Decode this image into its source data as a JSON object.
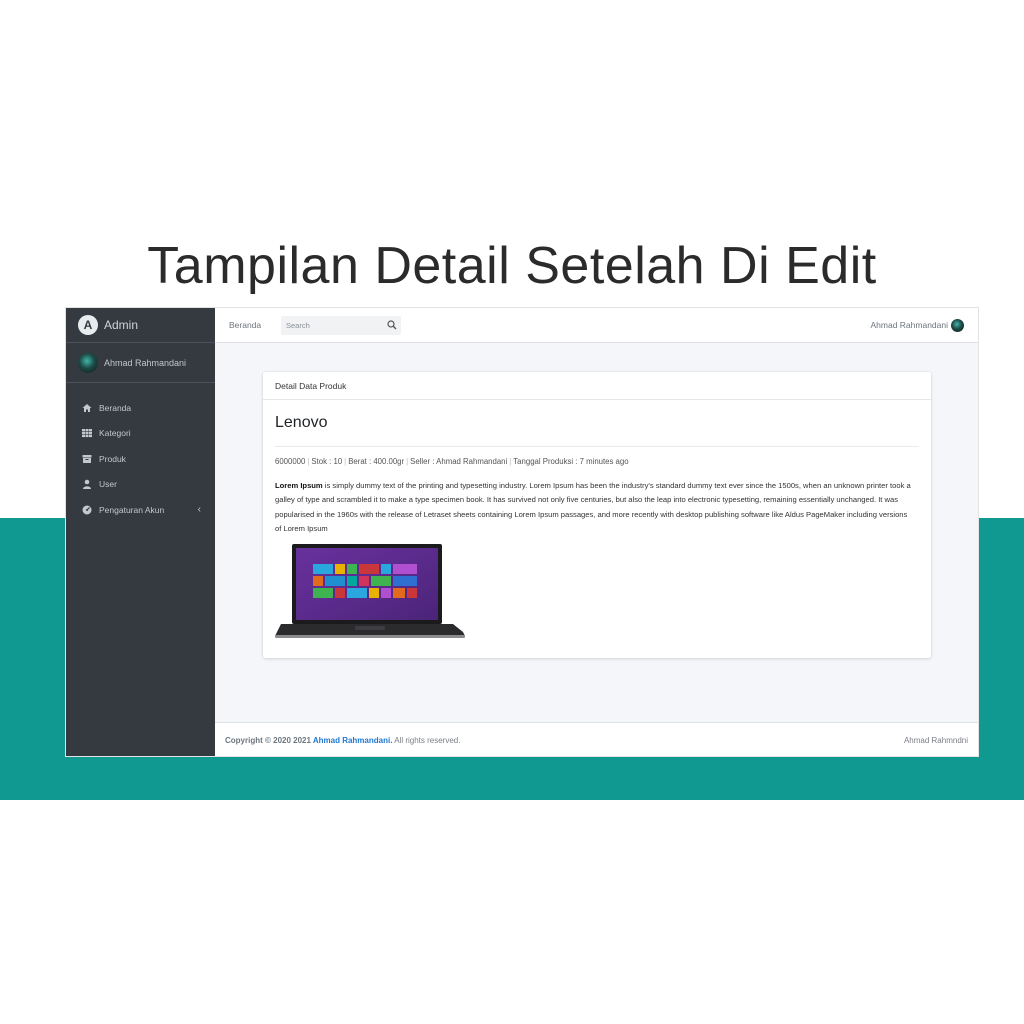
{
  "slide": {
    "title": "Tampilan Detail Setelah Di Edit",
    "accent_color": "#0f9990"
  },
  "sidebar": {
    "brand": "Admin",
    "brand_logo_letter": "A",
    "user_name": "Ahmad Rahmandani",
    "items": [
      {
        "label": "Beranda",
        "icon": "home-icon"
      },
      {
        "label": "Kategori",
        "icon": "grid-icon"
      },
      {
        "label": "Produk",
        "icon": "archive-icon"
      },
      {
        "label": "User",
        "icon": "user-icon"
      },
      {
        "label": "Pengaturan Akun",
        "icon": "gauge-icon",
        "chevron": "‹"
      }
    ]
  },
  "topbar": {
    "home_link": "Beranda",
    "search_placeholder": "Search",
    "user_name": "Ahmad Rahmandani"
  },
  "card": {
    "header": "Detail Data Produk",
    "product_name": "Lenovo",
    "meta": {
      "price": "6000000",
      "stock": "Stok : 10",
      "weight": "Berat : 400.00gr",
      "seller": "Seller : Ahmad Rahmandani",
      "production": "Tanggal Produksi : 7 minutes ago"
    },
    "description_lead": "Lorem Ipsum",
    "description_rest": " is simply dummy text of the printing and typesetting industry. Lorem Ipsum has been the industry's standard dummy text ever since the 1500s, when an unknown printer took a galley of type and scrambled it to make a type specimen book. It has survived not only five centuries, but also the leap into electronic typesetting, remaining essentially unchanged. It was popularised in the 1960s with the release of Letraset sheets containing Lorem Ipsum passages, and more recently with desktop publishing software like Aldus PageMaker including versions of Lorem Ipsum"
  },
  "footer": {
    "copyright_prefix": "Copyright © 2020 2021 ",
    "copyright_name": "Ahmad Rahmandani.",
    "copyright_suffix": " All rights reserved.",
    "right_text": "Ahmad Rahmndni"
  }
}
